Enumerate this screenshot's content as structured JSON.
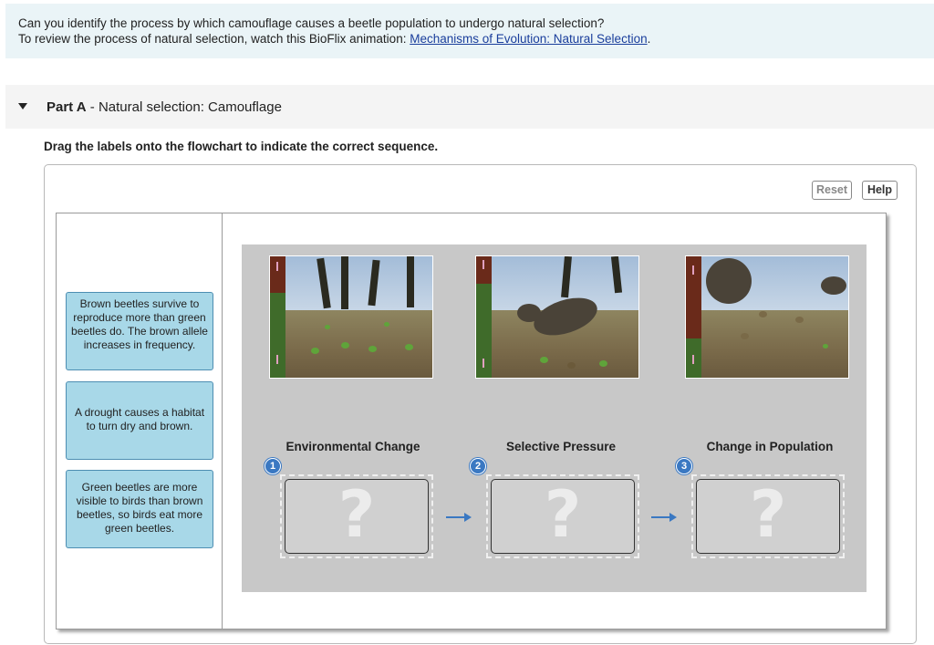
{
  "intro": {
    "line1": "Can you identify the process by which camouflage causes a beetle population to undergo natural selection?",
    "line2_prefix": "To review the process of natural selection, watch this BioFlix animation: ",
    "link": "Mechanisms of Evolution: Natural Selection",
    "line2_suffix": "."
  },
  "part": {
    "label": "Part A",
    "separator": " - ",
    "title": "Natural selection: Camouflage"
  },
  "instruction": "Drag the labels onto the flowchart to indicate the correct sequence.",
  "toolbar": {
    "reset_label": "Reset",
    "help_label": "Help"
  },
  "labels": [
    "Brown beetles survive to reproduce more than green beetles do. The brown allele increases in frequency.",
    "A drought causes a habitat to turn dry and brown.",
    "Green beetles are more visible to birds than brown beetles, so birds eat more green beetles."
  ],
  "stages": [
    {
      "number": "1",
      "title": "Environmental Change",
      "placeholder": "?"
    },
    {
      "number": "2",
      "title": "Selective Pressure",
      "placeholder": "?"
    },
    {
      "number": "3",
      "title": "Change in Population",
      "placeholder": "?"
    }
  ],
  "colors": {
    "label_fill": "#a8d8e8",
    "label_border": "#4d8eb2",
    "flow_background": "#c8c8c8",
    "step_badge": "#3a78c2",
    "link": "#1a3e9c",
    "arrow": "#3a78c2"
  },
  "icons": {
    "collapse": "triangle-down-icon",
    "flow_arrow": "arrow-right-icon"
  }
}
